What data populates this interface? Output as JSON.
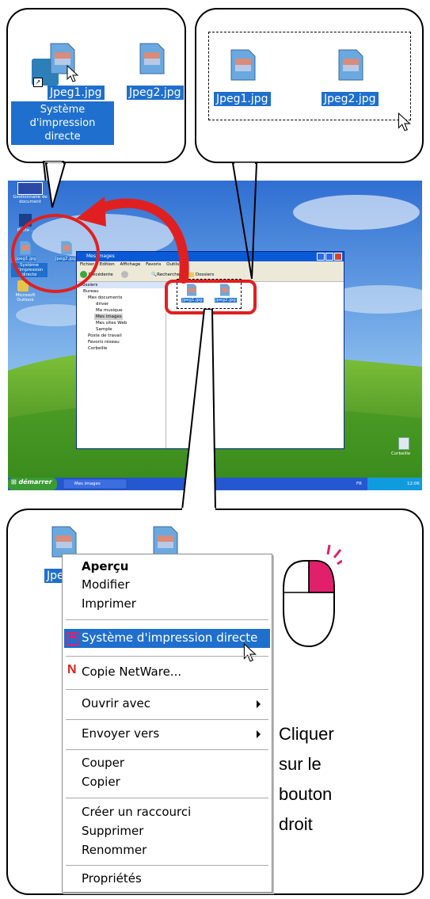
{
  "top_left_callout": {
    "file1": "Jpeg1.jpg",
    "file2": "Jpeg2.jpg",
    "shortcut_line1": "Système d'impression",
    "shortcut_line2": "directe"
  },
  "top_right_callout": {
    "file1": "Jpeg1.jpg",
    "file2": "Jpeg2.jpg"
  },
  "desktop": {
    "icon1": "Gestionnaire de document",
    "icon2": "Pilote ...",
    "icon3": "Système d'impression directe",
    "icon4": "Microsoft Outlook",
    "desk_file1": "Jpeg1.jpg",
    "desk_file2": "Jpeg2.jpg",
    "recycle": "Corbeille",
    "explorer": {
      "title": "Mes images",
      "menu": [
        "Fichier",
        "Edition",
        "Affichage",
        "Favoris",
        "Outils",
        "?"
      ],
      "back": "Précédente",
      "search": "Rechercher",
      "folders": "Dossiers",
      "pane_title": "Dossiers",
      "tree": [
        "Bureau",
        "Mes documents",
        "driver",
        "Ma musique",
        "Mes images",
        "Mes sites Web",
        "Sample",
        "Poste de travail",
        "Favoris réseau",
        "Corbeille"
      ],
      "file1": "Jpeg1.jpg",
      "file2": "Jpeg2.jpg"
    },
    "taskbar": {
      "start": "démarrer",
      "task": "Mes images",
      "lang": "FR",
      "clock": "12:06"
    }
  },
  "bottom_callout": {
    "file_partial": "Jpe",
    "menu": {
      "preview": "Aperçu",
      "edit": "Modifier",
      "print": "Imprimer",
      "direct_print": "Système d'impression directe",
      "netware": "Copie NetWare...",
      "open_with": "Ouvrir avec",
      "send_to": "Envoyer vers",
      "cut": "Couper",
      "copy": "Copier",
      "shortcut": "Créer un raccourci",
      "delete": "Supprimer",
      "rename": "Renommer",
      "properties": "Propriétés"
    },
    "instruction": [
      "Cliquer",
      "sur le",
      "bouton",
      "droit"
    ]
  },
  "colors": {
    "selection": "#1f6fce",
    "highlight_red": "#e02020",
    "mouse_accent": "#e0206a"
  }
}
